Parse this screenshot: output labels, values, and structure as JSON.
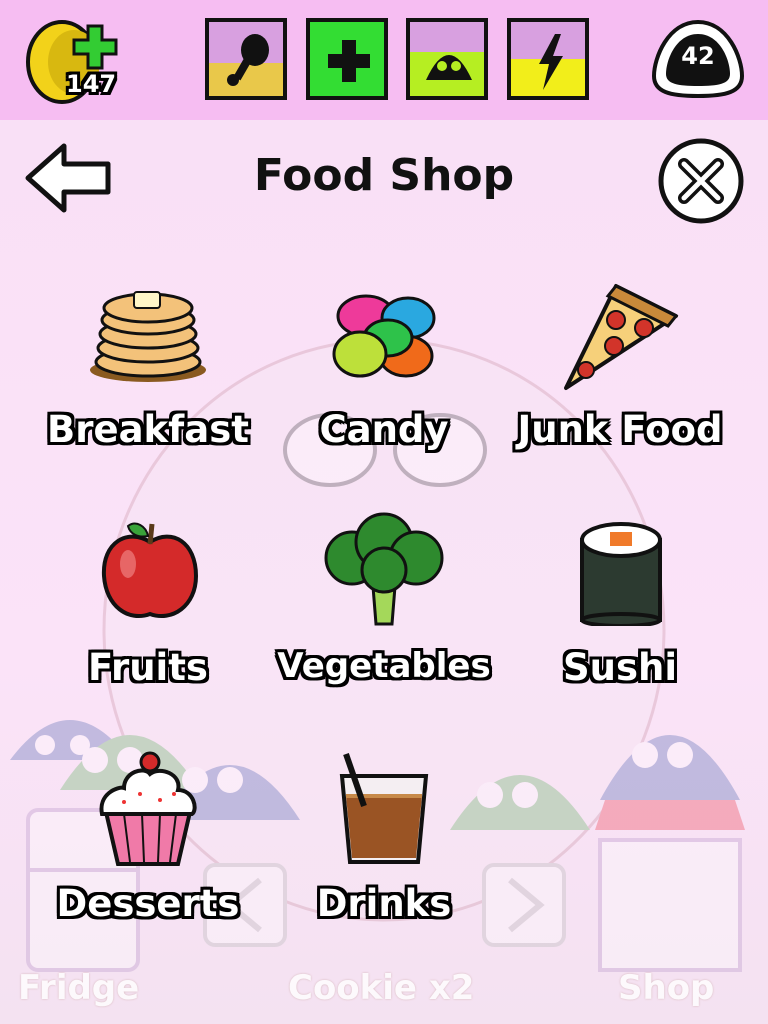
{
  "hud": {
    "coins": "147",
    "level": "42",
    "stats": [
      {
        "icon": "drumstick-icon",
        "fill": 0.45,
        "color": "#e9c84a"
      },
      {
        "icon": "health-plus-icon",
        "fill": 1.0,
        "color": "#33dd33"
      },
      {
        "icon": "happy-face-icon",
        "fill": 0.6,
        "color": "#b6ee22"
      },
      {
        "icon": "lightning-icon",
        "fill": 0.5,
        "color": "#f2ee1a"
      }
    ]
  },
  "header": {
    "title": "Food Shop"
  },
  "categories": [
    {
      "label": "Breakfast",
      "icon": "pancakes-icon"
    },
    {
      "label": "Candy",
      "icon": "jelly-beans-icon"
    },
    {
      "label": "Junk Food",
      "icon": "pizza-icon"
    },
    {
      "label": "Fruits",
      "icon": "apple-icon"
    },
    {
      "label": "Vegetables",
      "icon": "broccoli-icon"
    },
    {
      "label": "Sushi",
      "icon": "sushi-icon"
    },
    {
      "label": "Desserts",
      "icon": "cupcake-icon"
    },
    {
      "label": "Drinks",
      "icon": "drink-glass-icon"
    }
  ],
  "footer": {
    "left": "Fridge",
    "center": "Cookie x2",
    "right": "Shop"
  }
}
